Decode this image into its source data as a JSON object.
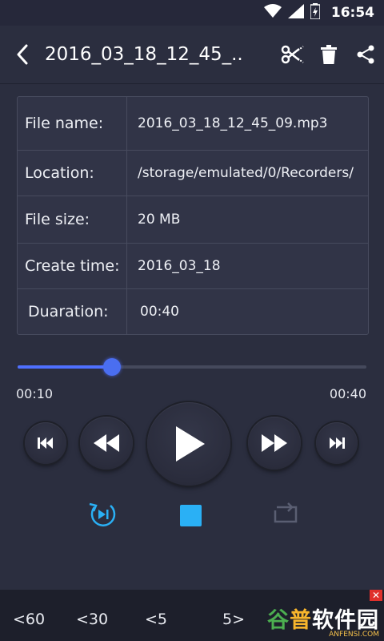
{
  "status_bar": {
    "time": "16:54"
  },
  "toolbar": {
    "title": "2016_03_18_12_45_..."
  },
  "file_info": {
    "rows": [
      {
        "label": "File name:",
        "value": "2016_03_18_12_45_09.mp3"
      },
      {
        "label": "Location:",
        "value": "/storage/emulated/0/Recorders/"
      },
      {
        "label": "File size:",
        "value": "20 MB"
      },
      {
        "label": "Create time:",
        "value": "2016_03_18"
      },
      {
        "label": "Duaration:",
        "value": "00:40"
      }
    ]
  },
  "player": {
    "current_time": "00:10",
    "total_time": "00:40",
    "progress_fraction": 0.27
  },
  "seek_buttons": {
    "back60": "<60",
    "back30": "<30",
    "back5": "<5",
    "fwd5": "5>"
  },
  "brand": {
    "name_green": "谷",
    "name_orange": "普",
    "name_rest": "软件园",
    "url": "ANFENSI.COM"
  },
  "ad": {
    "close_symbol": "✕"
  },
  "colors": {
    "accent": "#4f70ff",
    "stop": "#2ab0f5",
    "background": "#2b2e3f"
  }
}
